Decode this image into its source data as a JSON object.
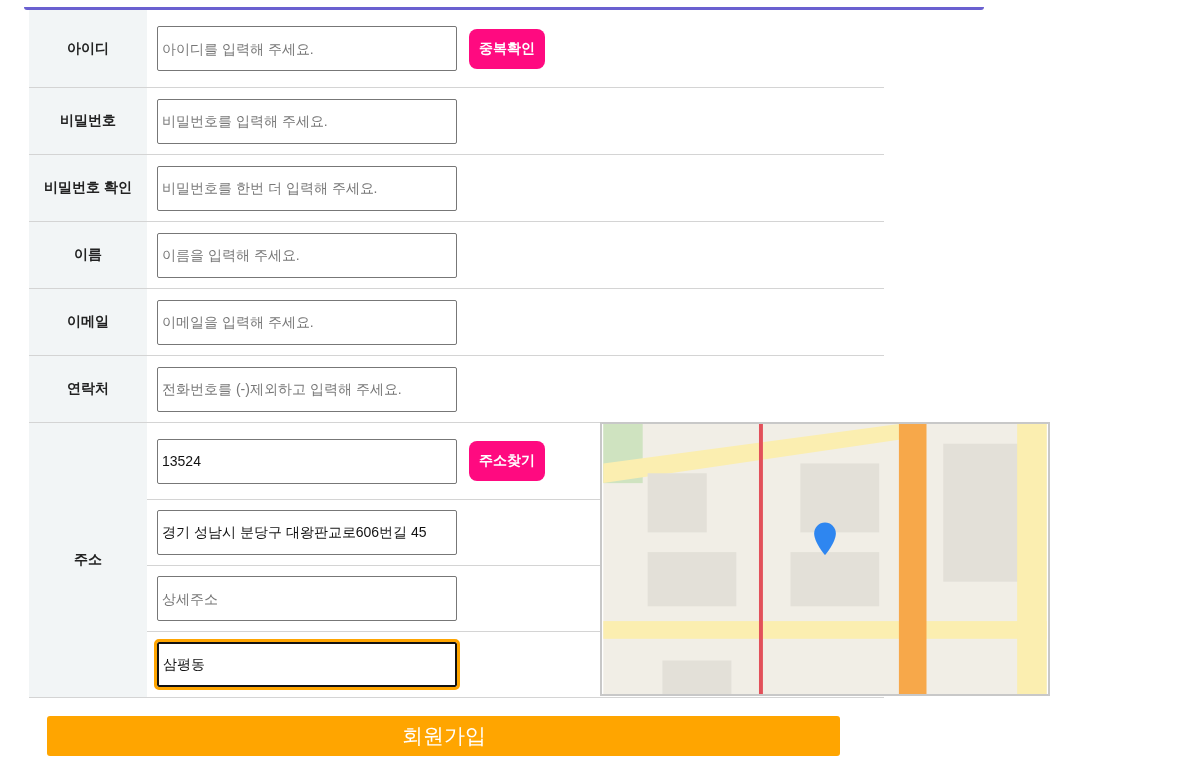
{
  "form": {
    "rows": [
      {
        "label": "아이디",
        "field": {
          "placeholder": "아이디를 입력해 주세요."
        },
        "button": "중복확인"
      },
      {
        "label": "비밀번호",
        "field": {
          "placeholder": "비밀번호를 입력해 주세요."
        }
      },
      {
        "label": "비밀번호 확인",
        "field": {
          "placeholder": "비밀번호를 한번 더 입력해 주세요."
        }
      },
      {
        "label": "이름",
        "field": {
          "placeholder": "이름을 입력해 주세요."
        }
      },
      {
        "label": "이메일",
        "field": {
          "placeholder": "이메일을 입력해 주세요."
        }
      },
      {
        "label": "연락처",
        "field": {
          "placeholder": "전화번호를 (-)제외하고 입력해 주세요."
        }
      }
    ],
    "address": {
      "label": "주소",
      "fields": [
        {
          "value": "13524",
          "focused": false,
          "button": "주소찾기"
        },
        {
          "value": "경기 성남시 분당구 대왕판교로606번길 45",
          "focused": false
        },
        {
          "placeholder": "상세주소",
          "focused": false
        },
        {
          "value": "삼평동",
          "focused": true
        }
      ]
    },
    "submit": "회원가입"
  }
}
